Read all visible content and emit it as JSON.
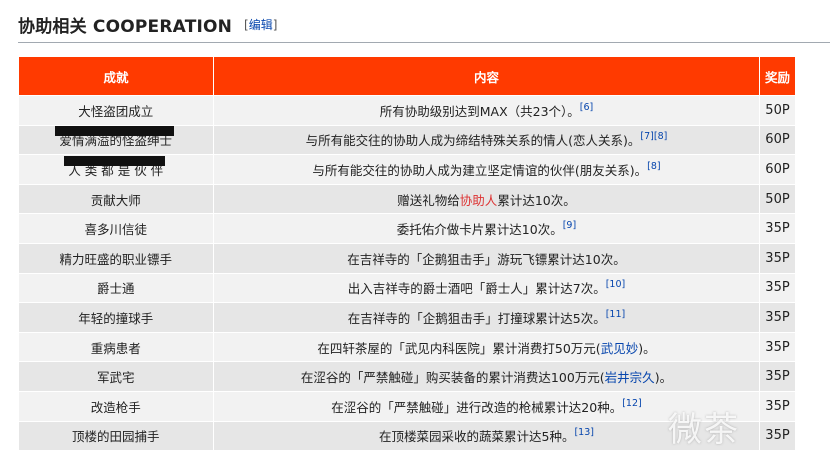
{
  "section": {
    "title": "协助相关 COOPERATION",
    "edit_open": "[",
    "edit_label": "编辑",
    "edit_close": "]"
  },
  "table": {
    "headers": [
      "成就",
      "内容",
      "奖励"
    ],
    "rows": [
      {
        "name": "大怪盗团成立",
        "pre": "所有协助级别达到MAX（共23个）。",
        "hl": "",
        "post": "",
        "link": "",
        "tail": "",
        "refs": "[6]",
        "reward": "50P"
      },
      {
        "name": "爱情满溢的怪盗绅士",
        "pre": "与所有能交往的协助人成为缔结特殊关系的情人(恋人关系)。",
        "hl": "",
        "post": "",
        "link": "",
        "tail": "",
        "refs": "[7][8]",
        "reward": "60P"
      },
      {
        "name": "人 类 都 是 伙 伴",
        "pre": "与所有能交往的协助人成为建立坚定情谊的伙伴(朋友关系)。",
        "hl": "",
        "post": "",
        "link": "",
        "tail": "",
        "refs": "[8]",
        "reward": "60P"
      },
      {
        "name": "贡献大师",
        "pre": "赠送礼物给",
        "hl": "协助人",
        "post": "累计达10次。",
        "link": "",
        "tail": "",
        "refs": "",
        "reward": "50P"
      },
      {
        "name": "喜多川信徒",
        "pre": "委托佑介做卡片累计达10次。",
        "hl": "",
        "post": "",
        "link": "",
        "tail": "",
        "refs": "[9]",
        "reward": "35P"
      },
      {
        "name": "精力旺盛的职业镖手",
        "pre": "在吉祥寺的「企鹅狙击手」游玩飞镖累计达10次。",
        "hl": "",
        "post": "",
        "link": "",
        "tail": "",
        "refs": "",
        "reward": "35P"
      },
      {
        "name": "爵士通",
        "pre": "出入吉祥寺的爵士酒吧「爵士人」累计达7次。",
        "hl": "",
        "post": "",
        "link": "",
        "tail": "",
        "refs": "[10]",
        "reward": "35P"
      },
      {
        "name": "年轻的撞球手",
        "pre": "在吉祥寺的「企鹅狙击手」打撞球累计达5次。",
        "hl": "",
        "post": "",
        "link": "",
        "tail": "",
        "refs": "[11]",
        "reward": "35P"
      },
      {
        "name": "重病患者",
        "pre": "在四轩茶屋的「武见内科医院」累计消费打50万元(",
        "hl": "",
        "post": "",
        "link": "武见妙",
        "tail": ")。",
        "refs": "",
        "reward": "35P"
      },
      {
        "name": "军武宅",
        "pre": "在涩谷的「严禁触碰」购买装备的累计消费达100万元(",
        "hl": "",
        "post": "",
        "link": "岩井宗久",
        "tail": ")。",
        "refs": "",
        "reward": "35P"
      },
      {
        "name": "改造枪手",
        "pre": "在涩谷的「严禁触碰」进行改造的枪械累计达20种。",
        "hl": "",
        "post": "",
        "link": "",
        "tail": "",
        "refs": "[12]",
        "reward": "35P"
      },
      {
        "name": "顶楼的田园捕手",
        "pre": "在顶楼菜园采收的蔬菜累计达5种。",
        "hl": "",
        "post": "",
        "link": "",
        "tail": "",
        "refs": "[13]",
        "reward": "35P"
      }
    ]
  },
  "watermark": "微茶"
}
